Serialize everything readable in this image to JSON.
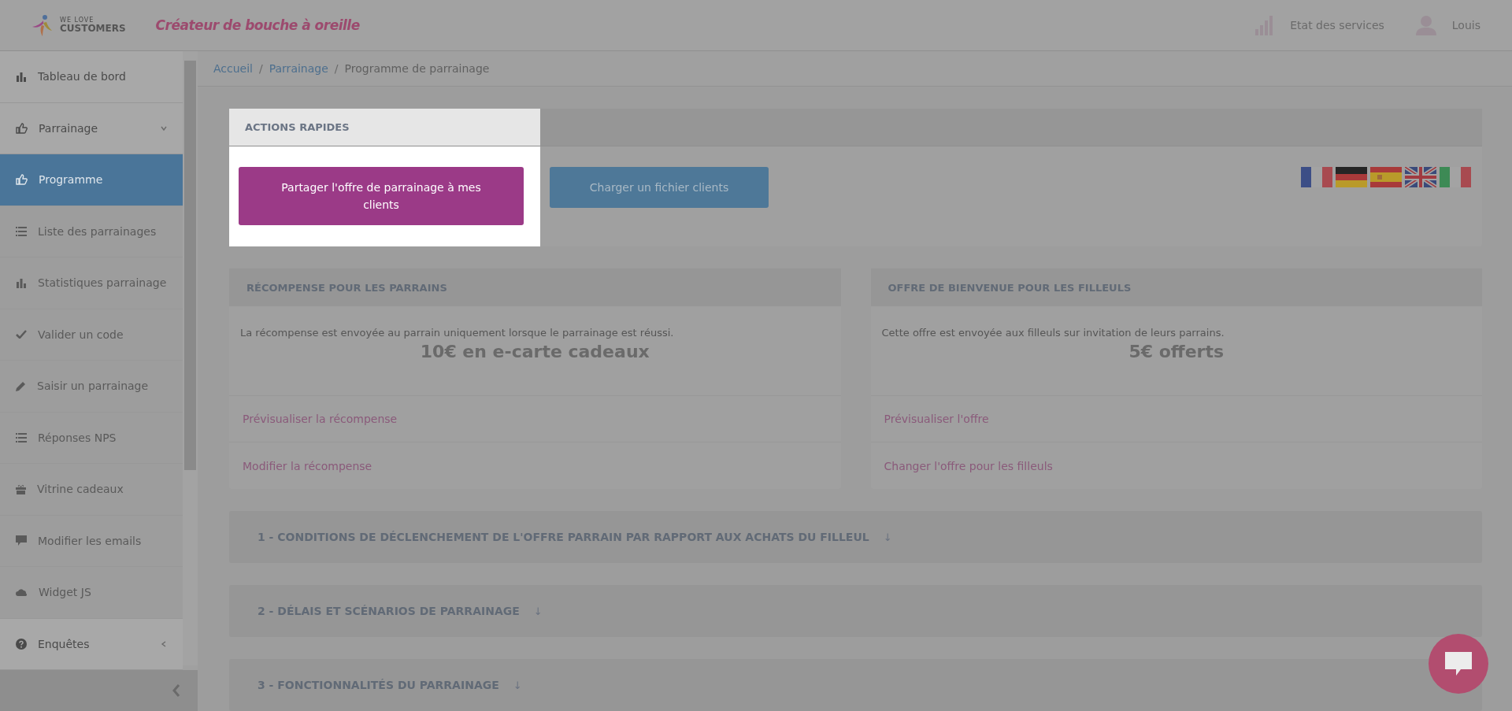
{
  "header": {
    "brand_small": "WE LOVE",
    "brand": "CUSTOMERS",
    "tagline": "Créateur de bouche à oreille",
    "services": "Etat des services",
    "user": "Louis"
  },
  "sidebar": {
    "items": [
      {
        "label": "Tableau de bord",
        "selected": false
      },
      {
        "label": "Parrainage",
        "selected": false,
        "expanded": true,
        "children": [
          {
            "label": "Programme",
            "selected": true
          },
          {
            "label": "Liste des parrainages",
            "selected": false
          },
          {
            "label": "Statistiques parrainage",
            "selected": false
          },
          {
            "label": "Valider un code",
            "selected": false
          },
          {
            "label": "Saisir un parrainage",
            "selected": false
          },
          {
            "label": "Réponses NPS",
            "selected": false
          },
          {
            "label": "Vitrine cadeaux",
            "selected": false
          },
          {
            "label": "Modifier les emails",
            "selected": false
          },
          {
            "label": "Widget JS",
            "selected": false
          }
        ]
      },
      {
        "label": "Enquêtes",
        "selected": false,
        "expanded": false
      }
    ]
  },
  "breadcrumb_separators": [
    "/",
    "/"
  ],
  "breadcrumb": [
    {
      "label": "Accueil",
      "kind": "link"
    },
    {
      "label": "Parrainage",
      "kind": "link"
    },
    {
      "label": "Programme de parrainage",
      "kind": "current"
    }
  ],
  "quick_actions": {
    "title": "ACTIONS RAPIDES",
    "highlighted": true,
    "buttons": [
      "Partager l'offre de parrainage à mes clients",
      "Charger un fichier clients"
    ]
  },
  "cards": [
    {
      "title": "RÉCOMPENSE POUR LES PARRAINS",
      "text": "La récompense est envoyée au parrain uniquement lorsque le parrainage est réussi.",
      "value": "10€ en e-carte cadeaux",
      "links": [
        "Prévisualiser la récompense",
        "Modifier la récompense"
      ]
    },
    {
      "title": "OFFRE DE BIENVENUE POUR LES FILLEULS",
      "text": "Cette offre est envoyée aux filleuls sur invitation de leurs parrains.",
      "value": "5€ offerts",
      "links": [
        "Prévisualiser l'offre",
        "Changer l'offre pour les filleuls"
      ]
    }
  ],
  "sections": [
    {
      "title": "1 - CONDITIONS DE DÉCLENCHEMENT DE L'OFFRE PARRAIN PAR RAPPORT AUX ACHATS DU FILLEUL",
      "arrow": "↓"
    },
    {
      "title": "2 - DÉLAIS ET SCÉNARIOS DE PARRAINAGE",
      "arrow": "↓"
    },
    {
      "title": "3 - FONCTIONNALITÉS DU PARRAINAGE",
      "arrow": "↓"
    }
  ]
}
